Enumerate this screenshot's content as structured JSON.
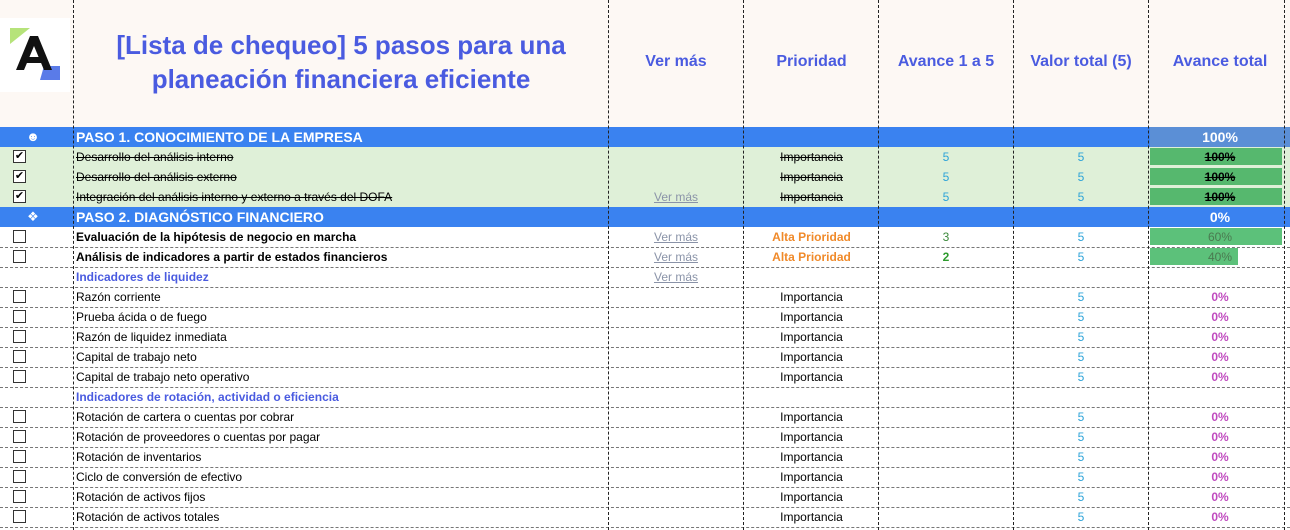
{
  "header": {
    "title_line1": "[Lista de chequeo] 5 pasos para una",
    "title_line2": "planeación financiera eficiente",
    "col_ver_mas": "Ver más",
    "col_prioridad": "Prioridad",
    "col_avance": "Avance 1 a 5",
    "col_valor": "Valor total (5)",
    "col_avance_total": "Avance total"
  },
  "paso1": {
    "title": "PASO 1. CONOCIMIENTO DE LA EMPRESA",
    "pct": "100%",
    "rows": [
      {
        "checked": "✔",
        "label": "Desarrollo del análisis interno",
        "ver": "",
        "prioridad": "Importancia",
        "avance": "5",
        "valor": "5",
        "total": "100%"
      },
      {
        "checked": "✔",
        "label": "Desarrollo del análisis externo",
        "ver": "",
        "prioridad": "Importancia",
        "avance": "5",
        "valor": "5",
        "total": "100%"
      },
      {
        "checked": "✔",
        "label": "Integración del análisis interno y externo a través del DOFA",
        "ver": "Ver más",
        "prioridad": "Importancia",
        "avance": "5",
        "valor": "5",
        "total": "100%"
      }
    ]
  },
  "paso2": {
    "title": "PASO 2. DIAGNÓSTICO FINANCIERO",
    "pct": "0%",
    "main_rows": [
      {
        "label": "Evaluación de la hipótesis de negocio en marcha",
        "ver": "Ver más",
        "prioridad": "Alta Prioridad",
        "avance": "3",
        "valor": "5",
        "total": "60%",
        "fraction": 0.6
      },
      {
        "label": "Análisis de indicadores a partir de estados financieros",
        "ver": "Ver más",
        "prioridad": "Alta Prioridad",
        "avance": "2",
        "valor": "5",
        "total": "40%",
        "fraction": 0.4
      }
    ],
    "liquidez_title": "Indicadores de liquidez",
    "liquidez_ver": "Ver más",
    "liquidez": [
      {
        "label": "Razón corriente",
        "prioridad": "Importancia",
        "valor": "5",
        "total": "0%"
      },
      {
        "label": "Prueba ácida o de fuego",
        "prioridad": "Importancia",
        "valor": "5",
        "total": "0%"
      },
      {
        "label": "Razón de liquidez inmediata",
        "prioridad": "Importancia",
        "valor": "5",
        "total": "0%"
      },
      {
        "label": "Capital de trabajo neto",
        "prioridad": "Importancia",
        "valor": "5",
        "total": "0%"
      },
      {
        "label": "Capital de trabajo neto operativo",
        "prioridad": "Importancia",
        "valor": "5",
        "total": "0%"
      }
    ],
    "rotacion_title": "Indicadores de rotación, actividad o eficiencia",
    "rotacion": [
      {
        "label": "Rotación de cartera o cuentas por cobrar",
        "prioridad": "Importancia",
        "valor": "5",
        "total": "0%"
      },
      {
        "label": "Rotación de proveedores o cuentas por pagar",
        "prioridad": "Importancia",
        "valor": "5",
        "total": "0%"
      },
      {
        "label": "Rotación de inventarios",
        "prioridad": "Importancia",
        "valor": "5",
        "total": "0%"
      },
      {
        "label": "Ciclo de conversión de efectivo",
        "prioridad": "Importancia",
        "valor": "5",
        "total": "0%"
      },
      {
        "label": "Rotación de activos fijos",
        "prioridad": "Importancia",
        "valor": "5",
        "total": "0%"
      },
      {
        "label": "Rotación de activos totales",
        "prioridad": "Importancia",
        "valor": "5",
        "total": "0%"
      }
    ]
  },
  "colors": {
    "section": "#3a82f0",
    "accent": "#4a5be0",
    "done": "#dff0d8",
    "bar": "#5cc17a",
    "high": "#f08a2a"
  }
}
